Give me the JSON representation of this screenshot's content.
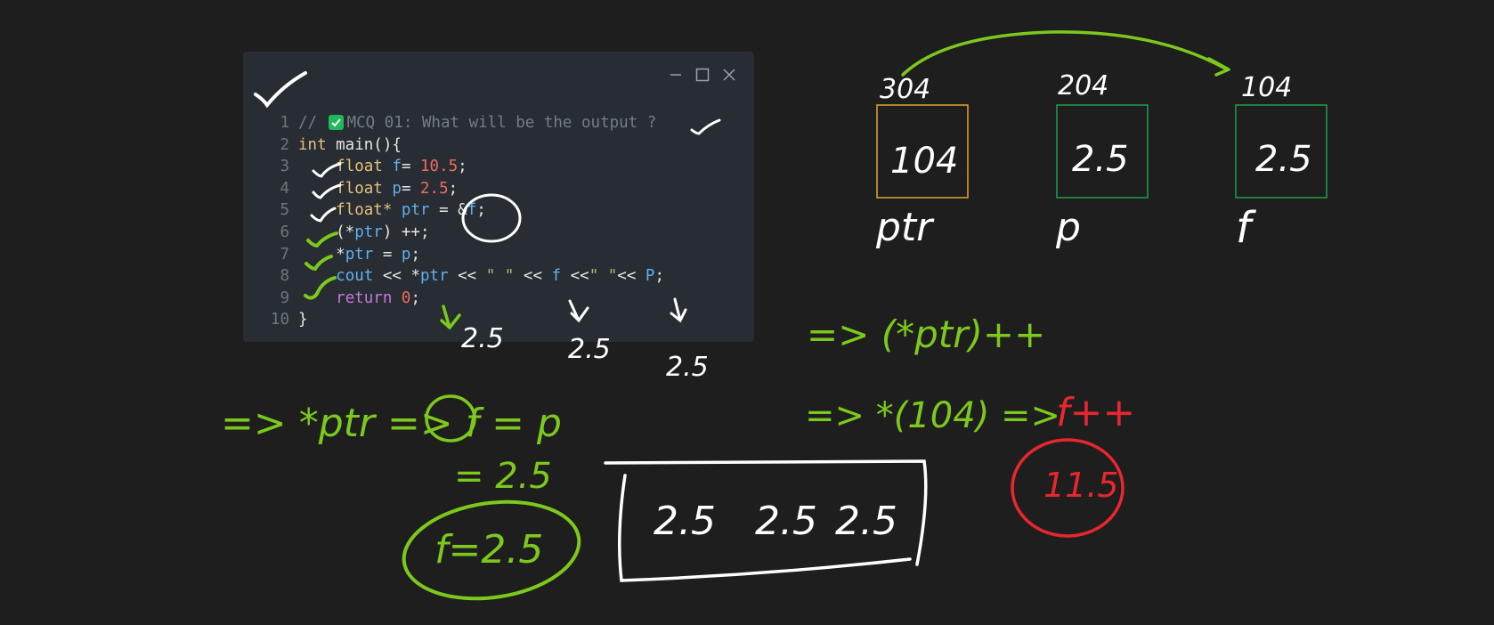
{
  "code": {
    "lines": [
      {
        "n": "1",
        "tokens": [
          {
            "t": "// ",
            "c": "comment"
          },
          {
            "emoji": "check"
          },
          {
            "t": "MCQ 01: What will be the output ?",
            "c": "comment"
          }
        ]
      },
      {
        "n": "2",
        "tokens": [
          {
            "t": "int",
            "c": "kw"
          },
          {
            "t": " main(){",
            "c": "plain"
          }
        ]
      },
      {
        "n": "3",
        "tokens": [
          {
            "t": "    ",
            "c": "plain"
          },
          {
            "t": "float",
            "c": "kw"
          },
          {
            "t": " ",
            "c": "plain"
          },
          {
            "t": "f",
            "c": "var"
          },
          {
            "t": "= ",
            "c": "plain"
          },
          {
            "t": "10.5",
            "c": "num"
          },
          {
            "t": ";",
            "c": "plain"
          }
        ]
      },
      {
        "n": "4",
        "tokens": [
          {
            "t": "    ",
            "c": "plain"
          },
          {
            "t": "float",
            "c": "kw"
          },
          {
            "t": " ",
            "c": "plain"
          },
          {
            "t": "p",
            "c": "var"
          },
          {
            "t": "= ",
            "c": "plain"
          },
          {
            "t": "2.5",
            "c": "num"
          },
          {
            "t": ";",
            "c": "plain"
          }
        ]
      },
      {
        "n": "5",
        "tokens": [
          {
            "t": "    ",
            "c": "plain"
          },
          {
            "t": "float*",
            "c": "kw"
          },
          {
            "t": " ",
            "c": "plain"
          },
          {
            "t": "ptr",
            "c": "var"
          },
          {
            "t": " = &",
            "c": "plain"
          },
          {
            "t": "f",
            "c": "var"
          },
          {
            "t": ";",
            "c": "plain"
          }
        ]
      },
      {
        "n": "6",
        "tokens": [
          {
            "t": "    (*",
            "c": "plain"
          },
          {
            "t": "ptr",
            "c": "var"
          },
          {
            "t": ") ++;",
            "c": "plain"
          }
        ]
      },
      {
        "n": "7",
        "tokens": [
          {
            "t": "    *",
            "c": "plain"
          },
          {
            "t": "ptr",
            "c": "var"
          },
          {
            "t": " = ",
            "c": "plain"
          },
          {
            "t": "p",
            "c": "var"
          },
          {
            "t": ";",
            "c": "plain"
          }
        ]
      },
      {
        "n": "8",
        "tokens": [
          {
            "t": "    ",
            "c": "plain"
          },
          {
            "t": "cout",
            "c": "var"
          },
          {
            "t": " << *",
            "c": "plain"
          },
          {
            "t": "ptr",
            "c": "var"
          },
          {
            "t": " << ",
            "c": "plain"
          },
          {
            "t": "\" \"",
            "c": "str"
          },
          {
            "t": " << ",
            "c": "plain"
          },
          {
            "t": "f",
            "c": "var"
          },
          {
            "t": " <<",
            "c": "plain"
          },
          {
            "t": "\" \"",
            "c": "str"
          },
          {
            "t": "<< ",
            "c": "plain"
          },
          {
            "t": "P",
            "c": "var"
          },
          {
            "t": ";",
            "c": "plain"
          }
        ]
      },
      {
        "n": "9",
        "tokens": [
          {
            "t": "    ",
            "c": "plain"
          },
          {
            "t": "return",
            "c": "purple"
          },
          {
            "t": " ",
            "c": "plain"
          },
          {
            "t": "0",
            "c": "num"
          },
          {
            "t": ";",
            "c": "plain"
          }
        ]
      },
      {
        "n": "10",
        "tokens": [
          {
            "t": "}",
            "c": "plain"
          }
        ]
      }
    ]
  },
  "memory_boxes": [
    {
      "address": "304",
      "value": "104",
      "name": "ptr",
      "color": "#e2a531"
    },
    {
      "address": "204",
      "value": "2.5",
      "name": "p",
      "color": "#1f9e4a"
    },
    {
      "address": "104",
      "value": "2.5",
      "name": "f",
      "color": "#1f9e4a"
    }
  ],
  "annotations": {
    "under_code": [
      "2.5",
      "2.5",
      "2.5"
    ],
    "step1": "=> (*ptr)++",
    "step2_prefix": "=> *(104) =>",
    "step2_suffix": "f++",
    "result_circle": "11.5",
    "line_star_ptr": "=> *ptr => f = p",
    "eq_value": "= 2.5",
    "f_circle": "f=2.5",
    "final_output": [
      "2.5",
      "2.5",
      "2.5"
    ]
  },
  "colors": {
    "background": "#1e1e1e",
    "window": "#272d33",
    "ink_white": "#ffffff",
    "ink_green": "#7cc81c",
    "ink_red": "#e8262d",
    "box_orange": "#e2a531",
    "box_green": "#1f9e4a"
  }
}
